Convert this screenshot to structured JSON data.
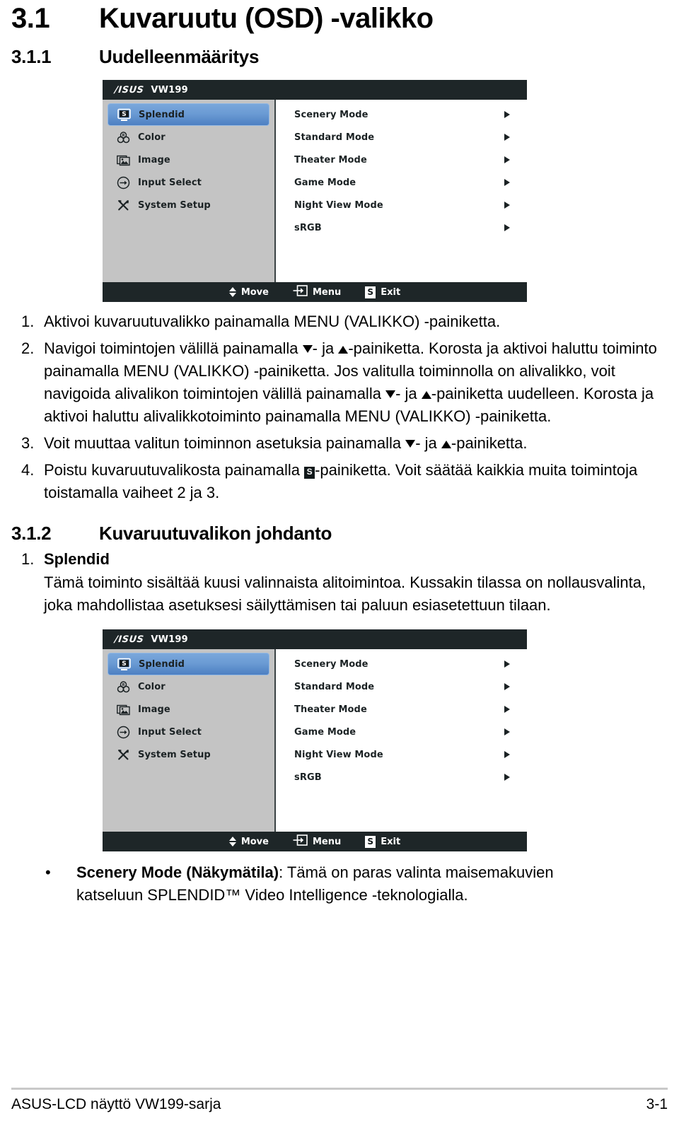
{
  "headings": {
    "h1_num": "3.1",
    "h1_text": "Kuvaruutu (OSD) -valikko",
    "h2a_num": "3.1.1",
    "h2a_text": "Uudelleenmääritys",
    "h2b_num": "3.1.2",
    "h2b_text": "Kuvaruutuvalikon johdanto"
  },
  "osd": {
    "brand": "/ISUS",
    "model": "VW199",
    "sidebar": [
      {
        "label": "Splendid",
        "icon": "splendid-s-monitor-icon",
        "selected": true
      },
      {
        "label": "Color",
        "icon": "color-rgb-circles-icon",
        "selected": false
      },
      {
        "label": "Image",
        "icon": "image-picture-icon",
        "selected": false
      },
      {
        "label": "Input Select",
        "icon": "input-arrow-circle-icon",
        "selected": false
      },
      {
        "label": "System Setup",
        "icon": "wrench-screwdriver-icon",
        "selected": false
      }
    ],
    "options": [
      {
        "label": "Scenery Mode",
        "arrow": "chevron-right-icon"
      },
      {
        "label": "Standard Mode",
        "arrow": "chevron-right-icon"
      },
      {
        "label": "Theater Mode",
        "arrow": "chevron-right-icon"
      },
      {
        "label": "Game Mode",
        "arrow": "chevron-right-icon"
      },
      {
        "label": "Night View Mode",
        "arrow": "chevron-right-icon"
      },
      {
        "label": "sRGB",
        "arrow": "chevron-right-icon"
      }
    ],
    "footbar": {
      "move_label": "Move",
      "move_icon": "up-down-arrows-icon",
      "menu_label": "Menu",
      "menu_icon": "enter-menu-icon",
      "exit_label": "Exit",
      "exit_icon": "splendid-s-badge-icon"
    },
    "colors": {
      "bar": "#1e2628",
      "sidebar": "#c4c4c4",
      "highlight_top": "#7aa7db",
      "highlight_bottom": "#4d80c2",
      "content": "#ffffff"
    }
  },
  "steps": {
    "n1": "1.",
    "t1": "Aktivoi kuvaruutuvalikko painamalla MENU (VALIKKO) -painiketta.",
    "n2": "2.",
    "t2a": "Navigoi toimintojen välillä painamalla ",
    "t2b": "- ja ",
    "t2c": "-painiketta. Korosta ja aktivoi haluttu toiminto painamalla MENU (VALIKKO) -painiketta. Jos valitulla toiminnolla on alivalikko, voit navigoida alivalikon toimintojen välillä painamalla ",
    "t2d": "- ja ",
    "t2e": "-painiketta uudelleen. Korosta ja aktivoi haluttu alivalikkotoiminto painamalla MENU (VALIKKO) -painiketta.",
    "n3": "3.",
    "t3a": "Voit muuttaa valitun toiminnon asetuksia painamalla ",
    "t3b": "- ja ",
    "t3c": "-painiketta.",
    "n4": "4.",
    "t4a": "Poistu kuvaruutuvalikosta painamalla ",
    "t4b": "-painiketta. Voit säätää kaikkia muita toimintoja toistamalla vaiheet 2 ja 3."
  },
  "splendid_section": {
    "num": "1.",
    "title": "Splendid",
    "paragraph": "Tämä toiminto sisältää kuusi valinnaista alitoimintoa. Kussakin tilassa on nollausvalinta, joka mahdollistaa asetuksesi säilyttämisen tai paluun esiasetettuun tilaan."
  },
  "bullet": {
    "dot": "•",
    "bold": "Scenery Mode (Näkymätila)",
    "rest": ": Tämä on paras valinta maisemakuvien katseluun SPLENDID™ Video Intelligence -teknologialla."
  },
  "footer": {
    "left": "ASUS-LCD näyttö VW199-sarja",
    "right": "3-1"
  }
}
